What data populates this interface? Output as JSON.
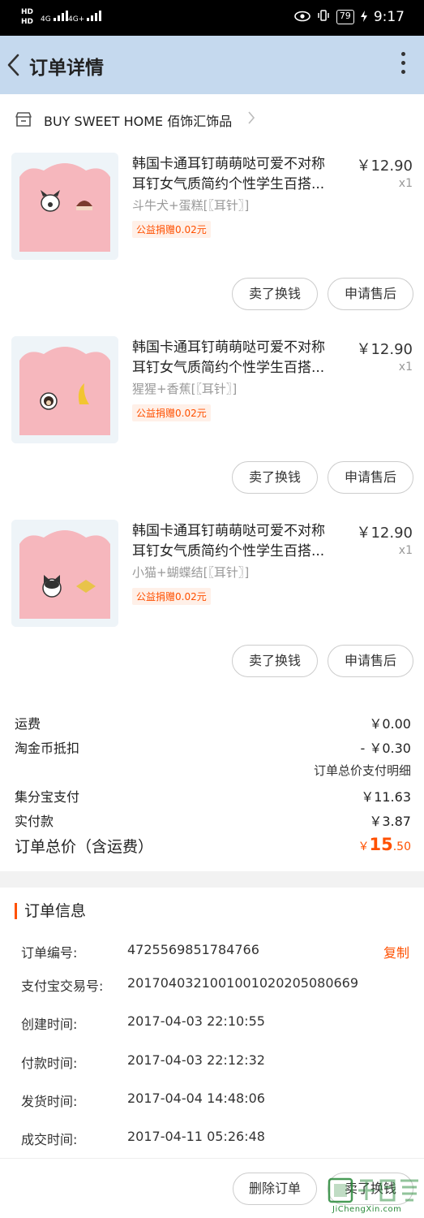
{
  "status_bar": {
    "left_badges": [
      "HD",
      "HD"
    ],
    "network_1": "4G",
    "network_2": "4G+",
    "battery": "79",
    "time": "9:17",
    "icons": [
      "eye-icon",
      "vibrate-icon",
      "battery-icon",
      "charging-icon"
    ]
  },
  "nav": {
    "title": "订单详情",
    "icons": [
      "back-arrow-icon",
      "more-vert-icon"
    ]
  },
  "shop": {
    "name": "BUY SWEET HOME 佰饰汇饰品",
    "icon": "store-icon"
  },
  "items": [
    {
      "title_line1": "韩国卡通耳钉萌萌哒可爱不对称",
      "title_line2": "耳钉女气质简约个性学生百搭...",
      "price": "￥12.90",
      "qty": "x1",
      "sku": "斗牛犬+蛋糕[〖耳针〗]",
      "donate": "公益捐赠0.02元",
      "btn_sell": "卖了换钱",
      "btn_after": "申请售后"
    },
    {
      "title_line1": "韩国卡通耳钉萌萌哒可爱不对称",
      "title_line2": "耳钉女气质简约个性学生百搭...",
      "price": "￥12.90",
      "qty": "x1",
      "sku": "猩猩+香蕉[〖耳针〗]",
      "donate": "公益捐赠0.02元",
      "btn_sell": "卖了换钱",
      "btn_after": "申请售后"
    },
    {
      "title_line1": "韩国卡通耳钉萌萌哒可爱不对称",
      "title_line2": "耳钉女气质简约个性学生百搭...",
      "price": "￥12.90",
      "qty": "x1",
      "sku": "小猫+蝴蝶结[〖耳针〗]",
      "donate": "公益捐赠0.02元",
      "btn_sell": "卖了换钱",
      "btn_after": "申请售后"
    }
  ],
  "summary": {
    "shipping_label": "运费",
    "shipping_value": "￥0.00",
    "coin_label": "淘金币抵扣",
    "coin_value": "- ￥0.30",
    "payment_detail_link": "订单总价支付明细",
    "jifenbao_label": "集分宝支付",
    "jifenbao_value": "￥11.63",
    "paid_label": "实付款",
    "paid_value": "￥3.87",
    "total_label": "订单总价（含运费）",
    "total_currency": "￥",
    "total_int": "15",
    "total_dec": ".50"
  },
  "order_info": {
    "section_title": "订单信息",
    "copy_label": "复制",
    "rows": [
      {
        "label": "订单编号:",
        "value": "4725569851784766"
      },
      {
        "label": "支付宝交易号:",
        "value": "2017040321001001020205080669"
      },
      {
        "label": "创建时间:",
        "value": "2017-04-03 22:10:55"
      },
      {
        "label": "付款时间:",
        "value": "2017-04-03 22:12:32"
      },
      {
        "label": "发货时间:",
        "value": "2017-04-04 14:48:06"
      },
      {
        "label": "成交时间:",
        "value": "2017-04-11 05:26:48"
      }
    ]
  },
  "bottom_bar": {
    "delete_label": "删除订单",
    "sell_label": "卖了换钱"
  },
  "watermark": {
    "site": "JiChengXin.com"
  },
  "colors": {
    "accent": "#ff5000",
    "nav_bg": "#c5d9ee"
  }
}
